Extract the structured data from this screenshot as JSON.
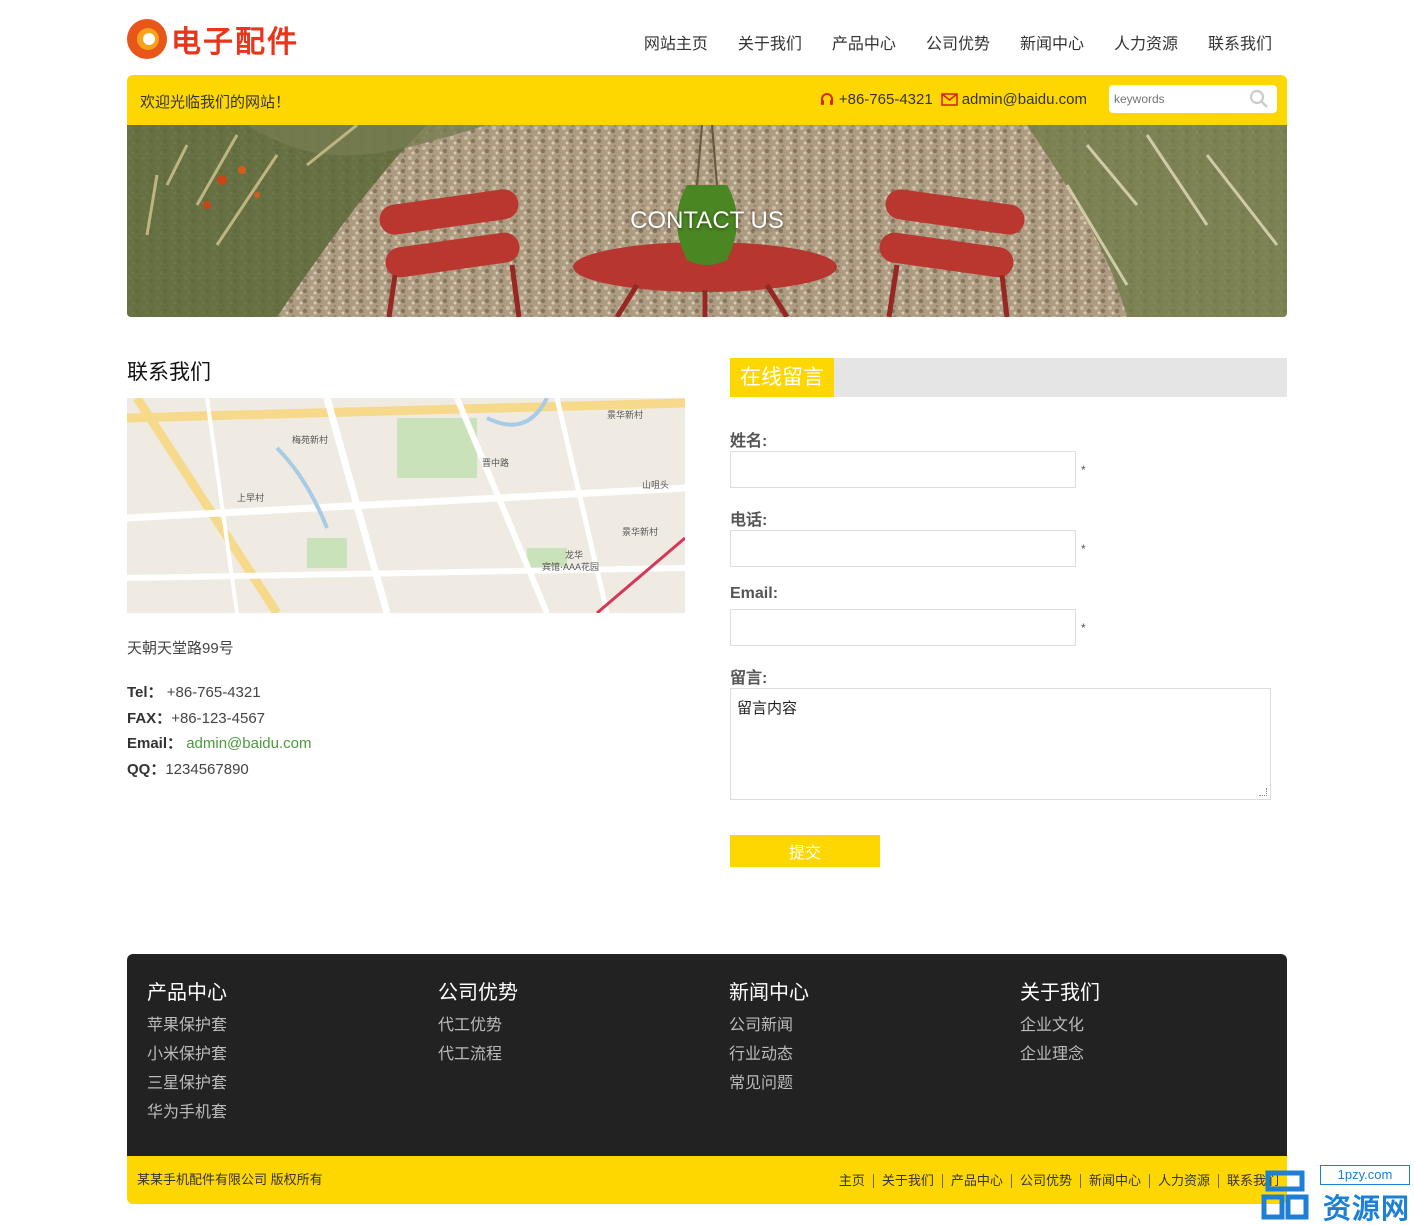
{
  "header": {
    "logo_text": "电子配件",
    "nav": [
      "网站主页",
      "关于我们",
      "产品中心",
      "公司优势",
      "新闻中心",
      "人力资源",
      "联系我们"
    ]
  },
  "topbar": {
    "welcome": "欢迎光临我们的网站！",
    "phone": "+86-765-4321",
    "email": "admin@baidu.com",
    "search_placeholder": "keywords"
  },
  "banner": {
    "title": "CONTACT US"
  },
  "contact": {
    "heading": "联系我们",
    "address": "天朝天堂路99号",
    "tel_label": "Tel：",
    "tel": "+86-765-4321",
    "fax_label": "FAX：",
    "fax": "+86-123-4567",
    "email_label": "Email：",
    "email": "admin@baidu.com",
    "qq_label": "QQ：",
    "qq": "1234567890"
  },
  "map_labels": [
    "梅苑新村",
    "景华新村",
    "上早村",
    "山咀头",
    "景华新村",
    "晋中路",
    "龙华",
    "宾馆·AAA花园"
  ],
  "form": {
    "heading": "在线留言",
    "name_label": "姓名:",
    "phone_label": "电话:",
    "email_label": "Email:",
    "message_label": "留言:",
    "message_value": "留言内容",
    "required_mark": "*",
    "submit_label": "提交"
  },
  "footer": {
    "columns": [
      {
        "title": "产品中心",
        "links": [
          "苹果保护套",
          "小米保护套",
          "三星保护套",
          "华为手机套"
        ]
      },
      {
        "title": "公司优势",
        "links": [
          "代工优势",
          "代工流程"
        ]
      },
      {
        "title": "新闻中心",
        "links": [
          "公司新闻",
          "行业动态",
          "常见问题"
        ]
      },
      {
        "title": "关于我们",
        "links": [
          "企业文化",
          "企业理念"
        ]
      }
    ],
    "copyright": "某某手机配件有限公司 版权所有",
    "links": [
      "主页",
      "关于我们",
      "产品中心",
      "公司优势",
      "新闻中心",
      "人力资源",
      "联系我们"
    ]
  },
  "watermark": {
    "domain": "1pzy.com",
    "name": "资源网"
  },
  "colors": {
    "accent": "#ffd700",
    "footer_bg": "#222222",
    "link_green": "#4a9a3c",
    "logo_red": "#e8361a"
  }
}
